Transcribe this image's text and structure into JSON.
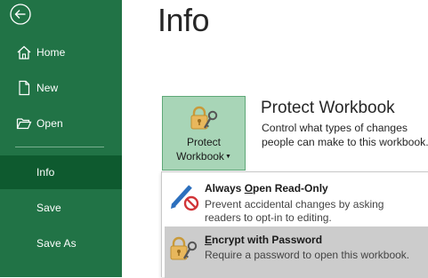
{
  "nav": {
    "items": [
      {
        "label": "Home",
        "icon": "home-icon"
      },
      {
        "label": "New",
        "icon": "new-document-icon"
      },
      {
        "label": "Open",
        "icon": "open-folder-icon"
      },
      {
        "label": "Info",
        "active": true
      },
      {
        "label": "Save"
      },
      {
        "label": "Save As"
      }
    ],
    "back_icon": "back-arrow-icon",
    "colors": {
      "background": "#217346",
      "active": "#0e5a2f"
    }
  },
  "main": {
    "title": "Info",
    "protect": {
      "button_line1": "Protect",
      "button_line2": "Workbook",
      "heading": "Protect Workbook",
      "desc_line1": "Control what types of changes",
      "desc_line2": "people can make to this workbook."
    }
  },
  "dropdown": {
    "items": [
      {
        "title_pre": "Always ",
        "title_accel": "O",
        "title_post": "pen Read-Only",
        "desc_line1": "Prevent accidental changes by asking",
        "desc_line2": "readers to opt-in to editing.",
        "icon": "pencil-no-edit-icon"
      },
      {
        "title_pre": "",
        "title_accel": "E",
        "title_post": "ncrypt with Password",
        "desc_line1": "Require a password to open this workbook.",
        "icon": "lock-key-icon",
        "highlighted": true
      }
    ]
  }
}
